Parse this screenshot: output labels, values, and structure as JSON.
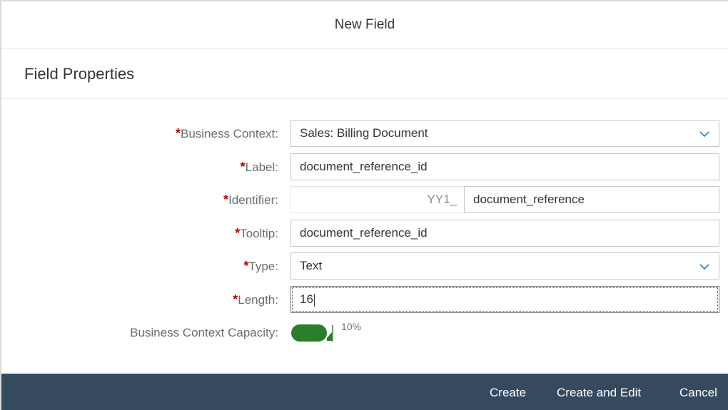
{
  "dialog": {
    "title": "New Field"
  },
  "section": {
    "title": "Field Properties"
  },
  "form": {
    "business_context": {
      "required_mark": "*",
      "label": "Business Context:",
      "value": "Sales: Billing Document"
    },
    "label_field": {
      "required_mark": "*",
      "label": "Label:",
      "value": "document_reference_id"
    },
    "identifier": {
      "required_mark": "*",
      "label": "Identifier:",
      "prefix": "YY1_",
      "value": "document_reference"
    },
    "tooltip": {
      "required_mark": "*",
      "label": "Tooltip:",
      "value": "document_reference_id"
    },
    "type": {
      "required_mark": "*",
      "label": "Type:",
      "value": "Text"
    },
    "length": {
      "required_mark": "*",
      "label": "Length:",
      "value": "16"
    },
    "capacity": {
      "label": "Business Context Capacity:",
      "value_text": "10%",
      "fill_fraction": 0.1,
      "color": "#2b7d2b"
    }
  },
  "footer": {
    "create_label": "Create",
    "create_edit_label": "Create and Edit",
    "cancel_label": "Cancel"
  },
  "colors": {
    "footer_bg": "#354a5f",
    "required": "#bb0000",
    "capacity_green": "#2b7d2b"
  }
}
